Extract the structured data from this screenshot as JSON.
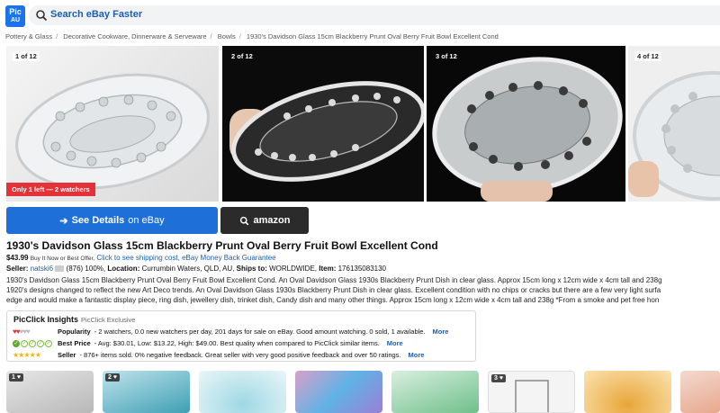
{
  "header": {
    "logo_top": "Pic",
    "logo_bottom": "AU",
    "search_label": "Search eBay Faster"
  },
  "breadcrumb": [
    "Pottery & Glass",
    "Decorative Cookware, Dinnerware & Serveware",
    "Bowls",
    "1930's Davidson Glass 15cm Blackberry Prunt Oval Berry Fruit Bowl Excellent Cond"
  ],
  "gallery": {
    "counters": [
      "1 of 12",
      "2 of 12",
      "3 of 12",
      "4 of 12"
    ],
    "watchers_badge": "Only 1 left — 2 watchers"
  },
  "buttons": {
    "ebay_prefix": "See Details",
    "ebay_suffix": "on eBay",
    "amazon_label": "amazon"
  },
  "listing": {
    "title": "1930's Davidson Glass 15cm Blackberry Prunt Oval Berry Fruit Bowl Excellent Cond",
    "price": "$43.99",
    "buy_options": "Buy It Now or Best Offer,",
    "shipping_link": "Click to see shipping cost,",
    "guarantee_link": "eBay Money Back Guarantee",
    "seller_label": "Seller:",
    "seller_name": "natski6",
    "seller_stats": "(876) 100%,",
    "location_label": "Location:",
    "location": "Currumbin Waters, QLD, AU,",
    "ships_label": "Ships to:",
    "ships_to": "WORLDWIDE,",
    "item_label": "Item:",
    "item_id": "176135083130",
    "description": [
      "1930's Davidson Glass 15cm Blackberry Prunt Oval Berry Fruit Bowl Excellent Cond. An Oval Davidson Glass 1930s Blackberry Prunt Dish in clear glass. Approx 15cm long x 12cm wide x 4cm tall and 238g",
      "1920's designs changed to reflect the new Art Deco trends. An Oval Davidson Glass 1930s Blackberry Prunt Dish in clear glass. Excellent condition with no chips or cracks but there are a few very light surfa",
      "edge and would make a fantastic display piece, ring dish, jewellery dish, trinket dish, Candy dish and many other things. Approx 15cm long x 12cm wide x 4cm tall and 238g *From a smoke and pet free hon"
    ]
  },
  "insights": {
    "title": "PicClick Insights",
    "exclusive": "PicClick Exclusive",
    "popularity_label": "Popularity",
    "popularity_text": "- 2 watchers, 0.0 new watchers per day, 201 days for sale on eBay. Good amount watching. 0 sold, 1 available.",
    "best_price_label": "Best Price",
    "best_price_text": "- Avg: $30.01, Low: $13.22, High: $49.00. Best quality when compared to PicClick similar items.",
    "seller_label": "Seller",
    "seller_text": "- 876+ items sold. 0% negative feedback. Great seller with very good positive feedback and over 50 ratings.",
    "more": "More",
    "popularity_hearts": 2,
    "best_price_checks": 1,
    "seller_stars": 5
  },
  "related": {
    "badges": [
      "1 ♥",
      "2 ♥",
      "3 ♥"
    ]
  },
  "colors": {
    "ebay_blue": "#1f6fd8",
    "amazon_dark": "#2b2b2b",
    "alert_red": "#e53238",
    "link_blue": "#1a5fb4"
  }
}
